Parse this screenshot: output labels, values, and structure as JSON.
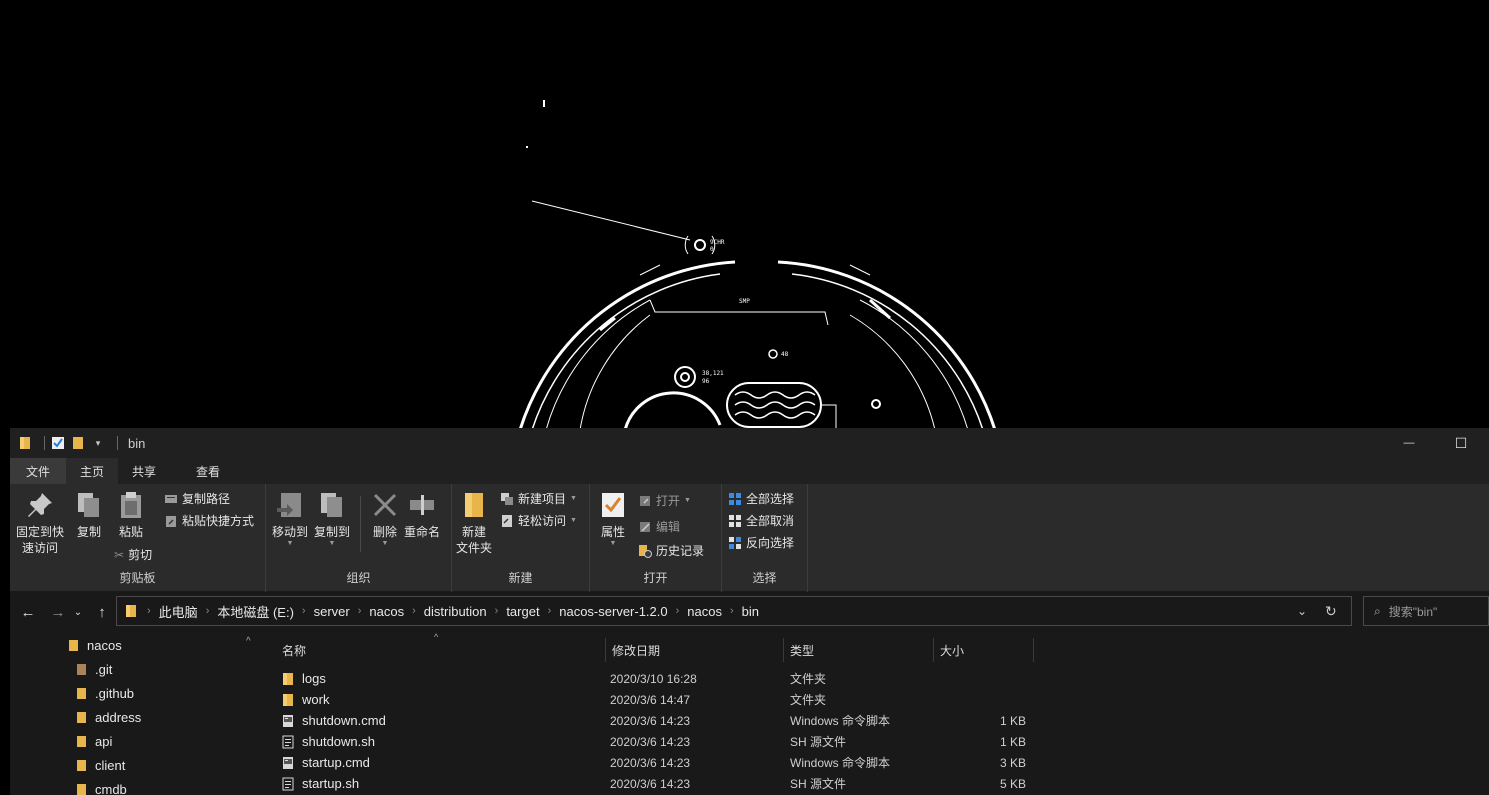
{
  "wallpaper": {
    "hud_labels": [
      "9CHR",
      "0",
      "SMP",
      "38,121",
      "96",
      "48"
    ]
  },
  "window": {
    "title": "bin",
    "controls": {
      "minimize": "—",
      "maximize": "☐"
    }
  },
  "tabs": [
    {
      "label": "文件"
    },
    {
      "label": "主页"
    },
    {
      "label": "共享"
    },
    {
      "label": "查看"
    }
  ],
  "ribbon": {
    "clipboard": {
      "label": "剪贴板",
      "pin": "固定到快速访问",
      "pin_line1": "固定到快",
      "pin_line2": "速访问",
      "copy": "复制",
      "paste": "粘贴",
      "copy_path": "复制路径",
      "paste_shortcut": "粘贴快捷方式",
      "cut": "剪切"
    },
    "organize": {
      "label": "组织",
      "move_to": "移动到",
      "copy_to": "复制到",
      "delete": "删除",
      "rename": "重命名"
    },
    "new": {
      "label": "新建",
      "new_folder_line1": "新建",
      "new_folder_line2": "文件夹",
      "new_item": "新建项目",
      "easy_access": "轻松访问"
    },
    "open": {
      "label": "打开",
      "properties": "属性",
      "open": "打开",
      "edit": "编辑",
      "history": "历史记录"
    },
    "select": {
      "label": "选择",
      "select_all": "全部选择",
      "select_none": "全部取消",
      "invert": "反向选择"
    }
  },
  "breadcrumb": [
    "此电脑",
    "本地磁盘 (E:)",
    "server",
    "nacos",
    "distribution",
    "target",
    "nacos-server-1.2.0",
    "nacos",
    "bin"
  ],
  "search": {
    "placeholder": "搜索\"bin\""
  },
  "tree": [
    {
      "label": "nacos"
    },
    {
      "label": ".git"
    },
    {
      "label": ".github"
    },
    {
      "label": "address"
    },
    {
      "label": "api"
    },
    {
      "label": "client"
    },
    {
      "label": "cmdb"
    }
  ],
  "columns": {
    "name": "名称",
    "modified": "修改日期",
    "type": "类型",
    "size": "大小"
  },
  "files": [
    {
      "name": "logs",
      "modified": "2020/3/10 16:28",
      "type": "文件夹",
      "size": "",
      "icon": "folder-icon"
    },
    {
      "name": "work",
      "modified": "2020/3/6 14:47",
      "type": "文件夹",
      "size": "",
      "icon": "folder-icon"
    },
    {
      "name": "shutdown.cmd",
      "modified": "2020/3/6 14:23",
      "type": "Windows 命令脚本",
      "size": "1 KB",
      "icon": "cmd-file-icon"
    },
    {
      "name": "shutdown.sh",
      "modified": "2020/3/6 14:23",
      "type": "SH 源文件",
      "size": "1 KB",
      "icon": "sh-file-icon"
    },
    {
      "name": "startup.cmd",
      "modified": "2020/3/6 14:23",
      "type": "Windows 命令脚本",
      "size": "3 KB",
      "icon": "cmd-file-icon"
    },
    {
      "name": "startup.sh",
      "modified": "2020/3/6 14:23",
      "type": "SH 源文件",
      "size": "5 KB",
      "icon": "sh-file-icon"
    }
  ],
  "colors": {
    "folder": "#e8b54a",
    "ribbon": "#2b2b2b",
    "background": "#191919",
    "accent": "#3b8be0"
  }
}
